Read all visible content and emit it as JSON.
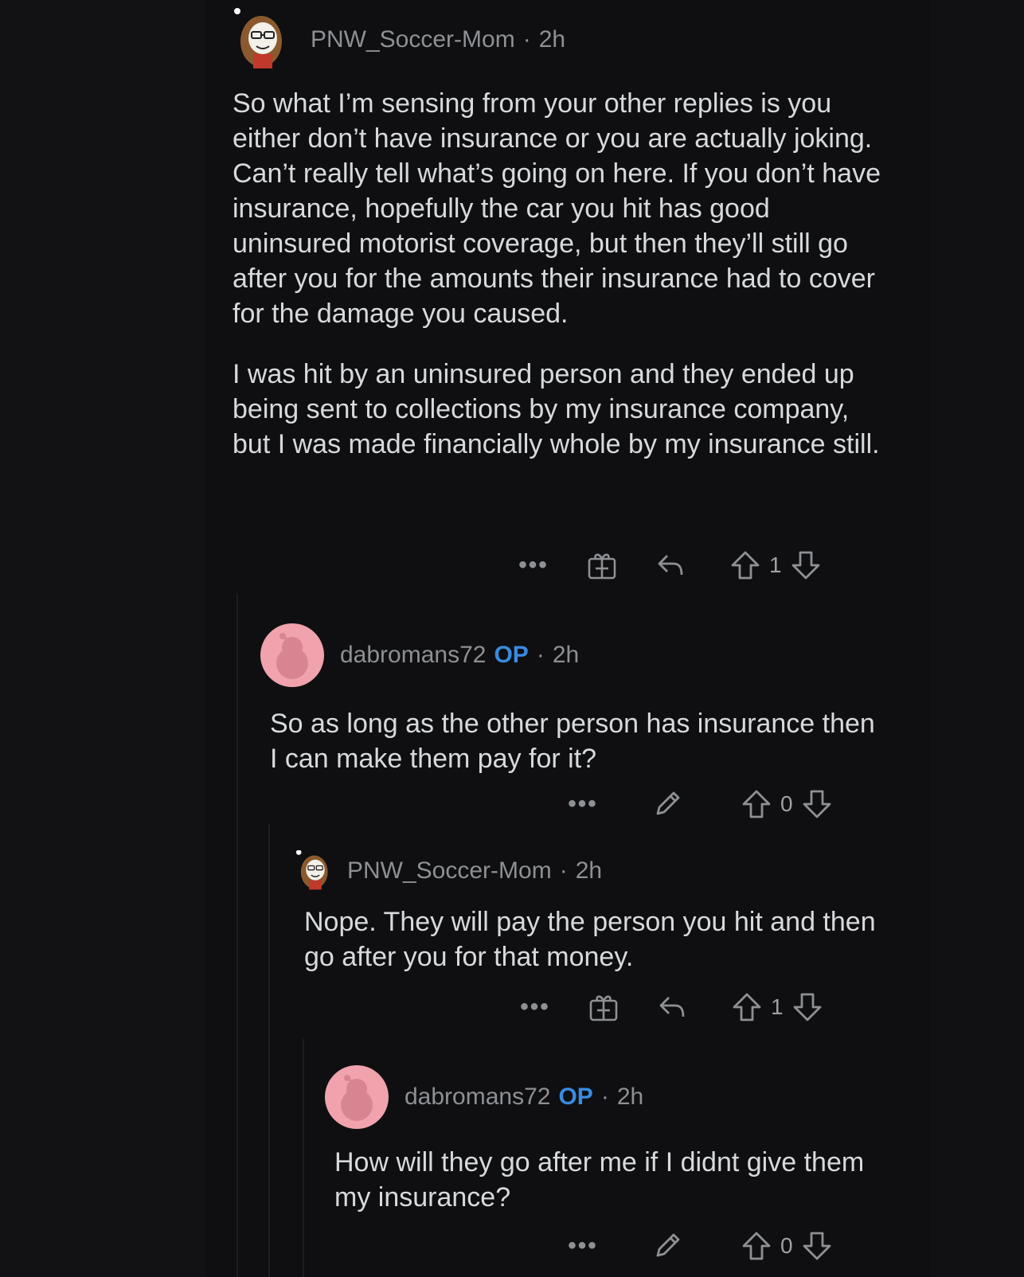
{
  "comments": [
    {
      "username": "PNW_Soccer-Mom",
      "time": "2h",
      "paragraphs": [
        "So what I’m sensing from your other replies is you either don’t have insurance or you are actually joking. Can’t really tell what’s going on here. If you don’t have insurance, hopefully the car you hit has good uninsured motorist coverage, but then they’ll still go after you for the amounts their insurance had to cover for the damage you caused.",
        "I was hit by an uninsured person and they ended up being sent to collections by my insurance company, but I was made financially whole by my insurance still."
      ],
      "votes": "1"
    },
    {
      "username": "dabromans72",
      "op_badge": "OP",
      "time": "2h",
      "paragraphs": [
        "So as long as the other person has insurance then I can make them pay for it?"
      ],
      "votes": "0"
    },
    {
      "username": "PNW_Soccer-Mom",
      "time": "2h",
      "paragraphs": [
        "Nope. They will pay the person you hit and then go after you for that money."
      ],
      "votes": "1"
    },
    {
      "username": "dabromans72",
      "op_badge": "OP",
      "time": "2h",
      "paragraphs": [
        "How will they go after me if I didnt give them my insurance?"
      ],
      "votes": "0"
    }
  ],
  "ui": {
    "more_glyph": "•••",
    "separator": "·"
  },
  "colors": {
    "background": "#0f0f11",
    "text": "#d7dadc",
    "meta": "#8d9094",
    "op_blue": "#3a8be0",
    "snoo_pink": "#f0a2ad"
  }
}
